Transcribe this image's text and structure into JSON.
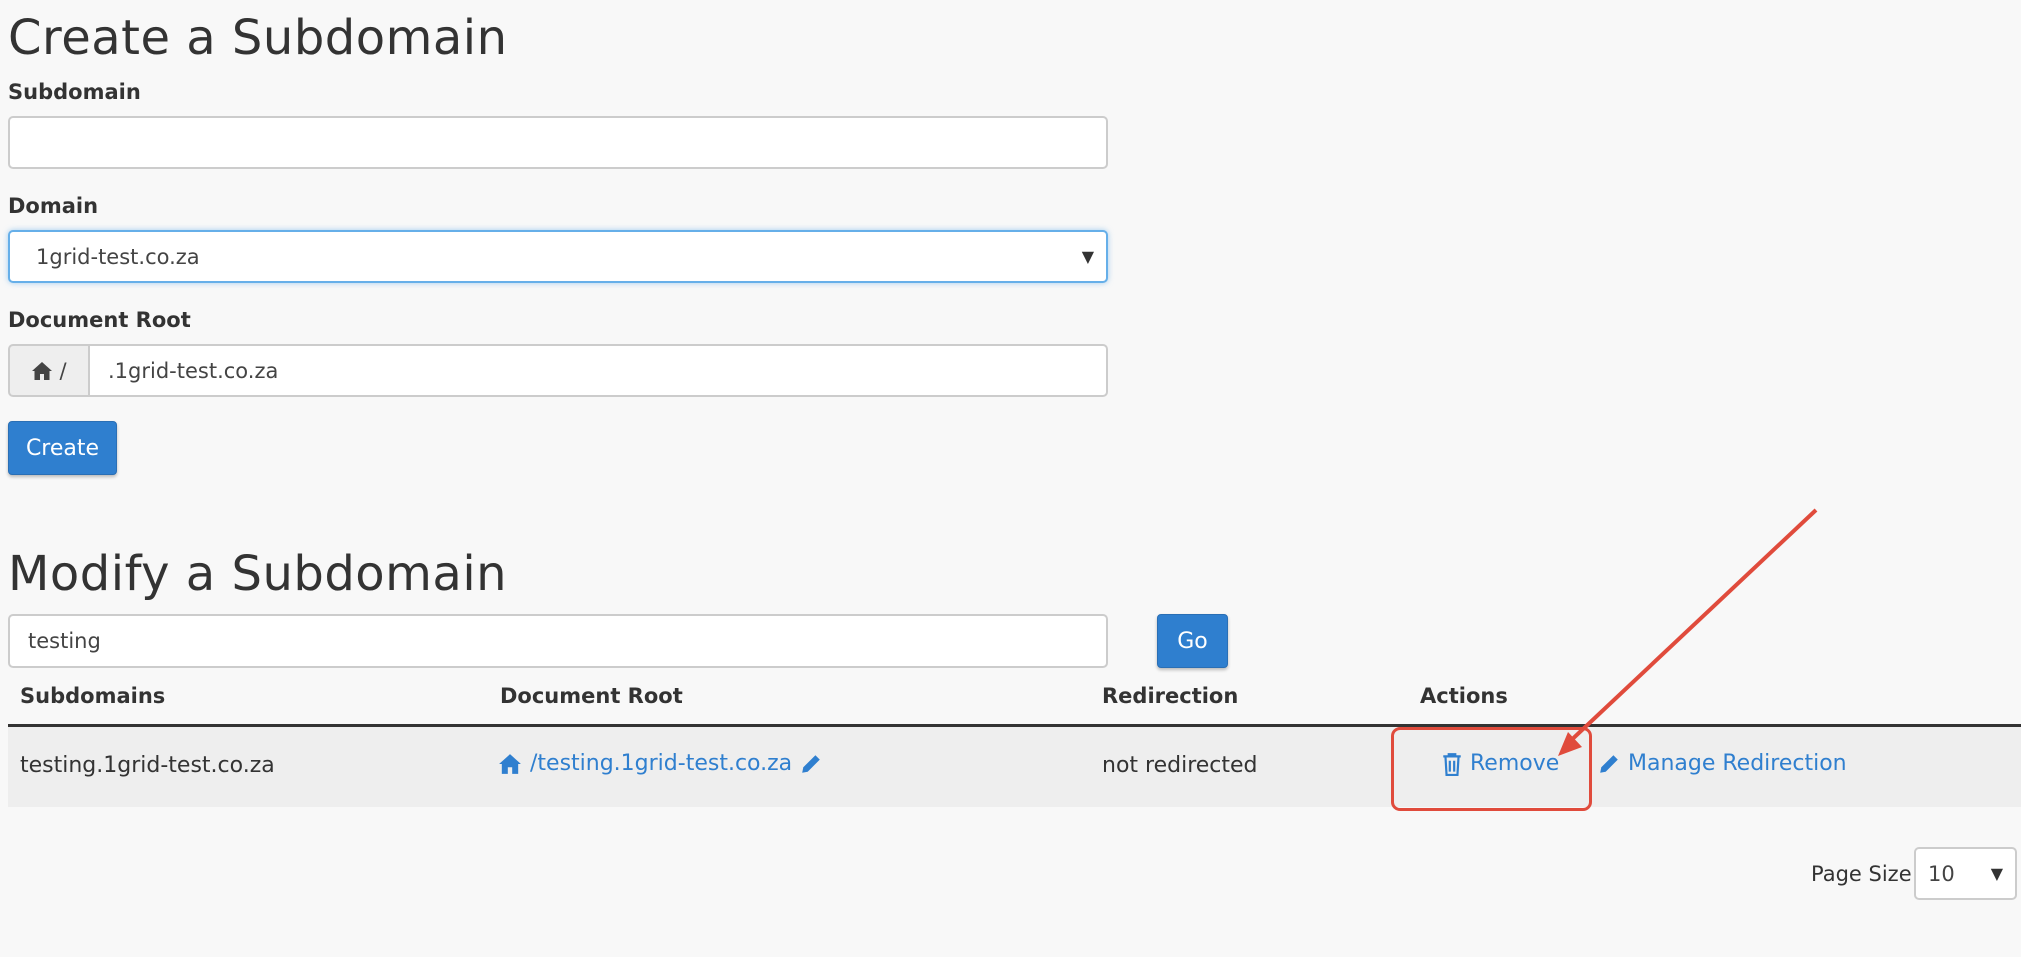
{
  "create": {
    "title": "Create a Subdomain",
    "subdomain_label": "Subdomain",
    "subdomain_value": "",
    "domain_label": "Domain",
    "domain_selected": "1grid-test.co.za",
    "docroot_label": "Document Root",
    "docroot_prefix": "/",
    "docroot_value": ".1grid-test.co.za",
    "create_button": "Create"
  },
  "modify": {
    "title": "Modify a Subdomain",
    "search_value": "testing",
    "go_button": "Go",
    "columns": [
      "Subdomains",
      "Document Root",
      "Redirection",
      "Actions"
    ],
    "rows": [
      {
        "subdomain": "testing.1grid-test.co.za",
        "document_root": "/testing.1grid-test.co.za",
        "redirection": "not redirected",
        "remove_label": "Remove",
        "manage_label": "Manage Redirection"
      }
    ],
    "page_size_label": "Page Size",
    "page_size_value": "10"
  },
  "colors": {
    "accent": "#2f7fcf",
    "annotation": "#e04b3c",
    "row_bg": "#eeeeee"
  }
}
